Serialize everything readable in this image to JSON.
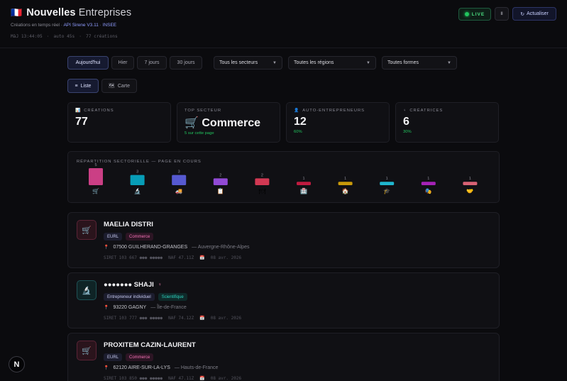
{
  "header": {
    "flag": "🇫🇷",
    "title_bold": "Nouvelles",
    "title_light": "Entreprises",
    "subtitle_prefix": "Créations en temps réel ·",
    "subtitle_link1": "API Sirene V3.11",
    "subtitle_sep": "·",
    "subtitle_link2": "INSEE",
    "status_updated": "MàJ 13:44:05",
    "status_auto": "auto 45s",
    "status_count": "77 créations",
    "live_label": "LIVE",
    "pause_label": "II",
    "refresh_icon": "↻",
    "refresh_label": "Actualiser"
  },
  "filters": {
    "periods": [
      "Aujourd'hui",
      "Hier",
      "7 jours",
      "30 jours"
    ],
    "active_period": 0,
    "sector": "Tous les secteurs",
    "region": "Toutes les régions",
    "form": "Toutes formes"
  },
  "views": {
    "list_icon": "≡",
    "list_label": "Liste",
    "map_icon": "🗺",
    "map_label": "Carte"
  },
  "stats": [
    {
      "icon": "📊",
      "label": "CRÉATIONS",
      "value": "77",
      "sub": ""
    },
    {
      "icon": "",
      "label": "TOP SECTEUR",
      "value": "🛒 Commerce",
      "sub": "5 sur cette page"
    },
    {
      "icon": "👤",
      "label": "AUTO-ENTREPRENEURS",
      "value": "12",
      "sub": "60%"
    },
    {
      "icon": "♀",
      "label": "CRÉATRICES",
      "value": "6",
      "sub": "30%"
    }
  ],
  "sector_chart": {
    "title": "RÉPARTITION SECTORIELLE — PAGE EN COURS"
  },
  "chart_data": {
    "type": "bar",
    "title": "RÉPARTITION SECTORIELLE — PAGE EN COURS",
    "categories": [
      "🛒",
      "🔬",
      "🚚",
      "📋",
      "🍽",
      "🏥",
      "🏠",
      "🎓",
      "🎭",
      "🤝"
    ],
    "values": [
      5,
      3,
      3,
      2,
      2,
      1,
      1,
      1,
      1,
      1
    ],
    "colors": [
      "#ec4899",
      "#06b6d4",
      "#6366f1",
      "#a855f7",
      "#f43f5e",
      "#e11d48",
      "#eab308",
      "#22d3ee",
      "#c026d3",
      "#fb7185"
    ],
    "ylim": [
      0,
      5
    ]
  },
  "companies": [
    {
      "icon": "🛒",
      "icon_kind": "commerce",
      "name": "MAELIA DISTRI",
      "female": "",
      "form": "EURL",
      "sector": "Commerce",
      "sector_kind": "commerce",
      "location": "07500 GUILHERAND-GRANGES",
      "region": "— Auvergne-Rhône-Alpes",
      "siret": "SIRET 103 667 ●●● ●●●●●",
      "naf": "NAF 47.11Z",
      "date_icon": "📅",
      "date": "08 avr. 2026"
    },
    {
      "icon": "🔬",
      "icon_kind": "science",
      "name": "●●●●●●● SHAJI",
      "female": "♀",
      "form": "Entrepreneur individuel",
      "sector": "Scientifique",
      "sector_kind": "science",
      "location": "93220 GAGNY",
      "region": "— Île-de-France",
      "siret": "SIRET 103 777 ●●● ●●●●●",
      "naf": "NAF 74.12Z",
      "date_icon": "📅",
      "date": "08 avr. 2026"
    },
    {
      "icon": "🛒",
      "icon_kind": "commerce",
      "name": "PROXITEM CAZIN-LAURENT",
      "female": "",
      "form": "EURL",
      "sector": "Commerce",
      "sector_kind": "commerce",
      "location": "62120 AIRE-SUR-LA-LYS",
      "region": "— Hauts-de-France",
      "siret": "SIRET 103 850 ●●● ●●●●●",
      "naf": "NAF 47.11Z",
      "date_icon": "📅",
      "date": "08 avr. 2026"
    }
  ],
  "fab_label": "N"
}
